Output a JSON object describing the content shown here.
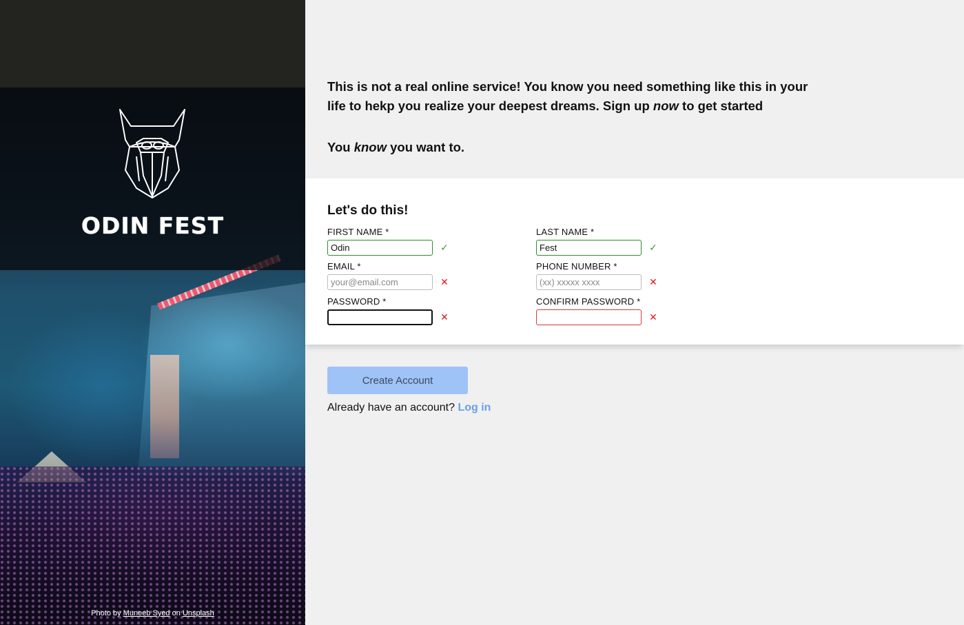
{
  "sidebar": {
    "brand": "ODIN FEST",
    "logo_icon": "viking-helmet-icon",
    "credit": {
      "prefix": "Photo by",
      "author": "Muneeb Syed",
      "middle": "on",
      "site": "Unsplash"
    }
  },
  "intro": {
    "line1": "This is not a real online service! You know you need something like this in your life to hekp you realize your deepest dreams. Sign up ",
    "line1_emph": "now",
    "line1_end": " to get started",
    "line2_start": "You ",
    "line2_emph": "know",
    "line2_end": " you want to."
  },
  "form": {
    "title": "Let's do this!",
    "fields": {
      "first_name": {
        "label": "FIRST NAME *",
        "value": "Odin",
        "placeholder": "",
        "status": "valid",
        "mark": "✓"
      },
      "last_name": {
        "label": "LAST NAME *",
        "value": "Fest",
        "placeholder": "",
        "status": "valid",
        "mark": "✓"
      },
      "email": {
        "label": "EMAIL *",
        "value": "",
        "placeholder": "your@email.com",
        "status": "invalid",
        "mark": "✕"
      },
      "phone": {
        "label": "PHONE NUMBER *",
        "value": "",
        "placeholder": "(xx) xxxxx xxxx",
        "status": "invalid",
        "mark": "✕"
      },
      "password": {
        "label": "PASSWORD *",
        "value": "",
        "placeholder": "",
        "status": "invalid",
        "mark": "✕"
      },
      "confirm_password": {
        "label": "CONFIRM PASSWORD *",
        "value": "",
        "placeholder": "",
        "status": "invalid",
        "mark": "✕"
      }
    }
  },
  "actions": {
    "create_label": "Create Account",
    "login_prompt": "Already have an account?",
    "login_link": "Log in"
  },
  "colors": {
    "valid": "#2f8a2f",
    "invalid": "#e01818",
    "button": "#9fc3f6",
    "link": "#6a9fe6"
  }
}
